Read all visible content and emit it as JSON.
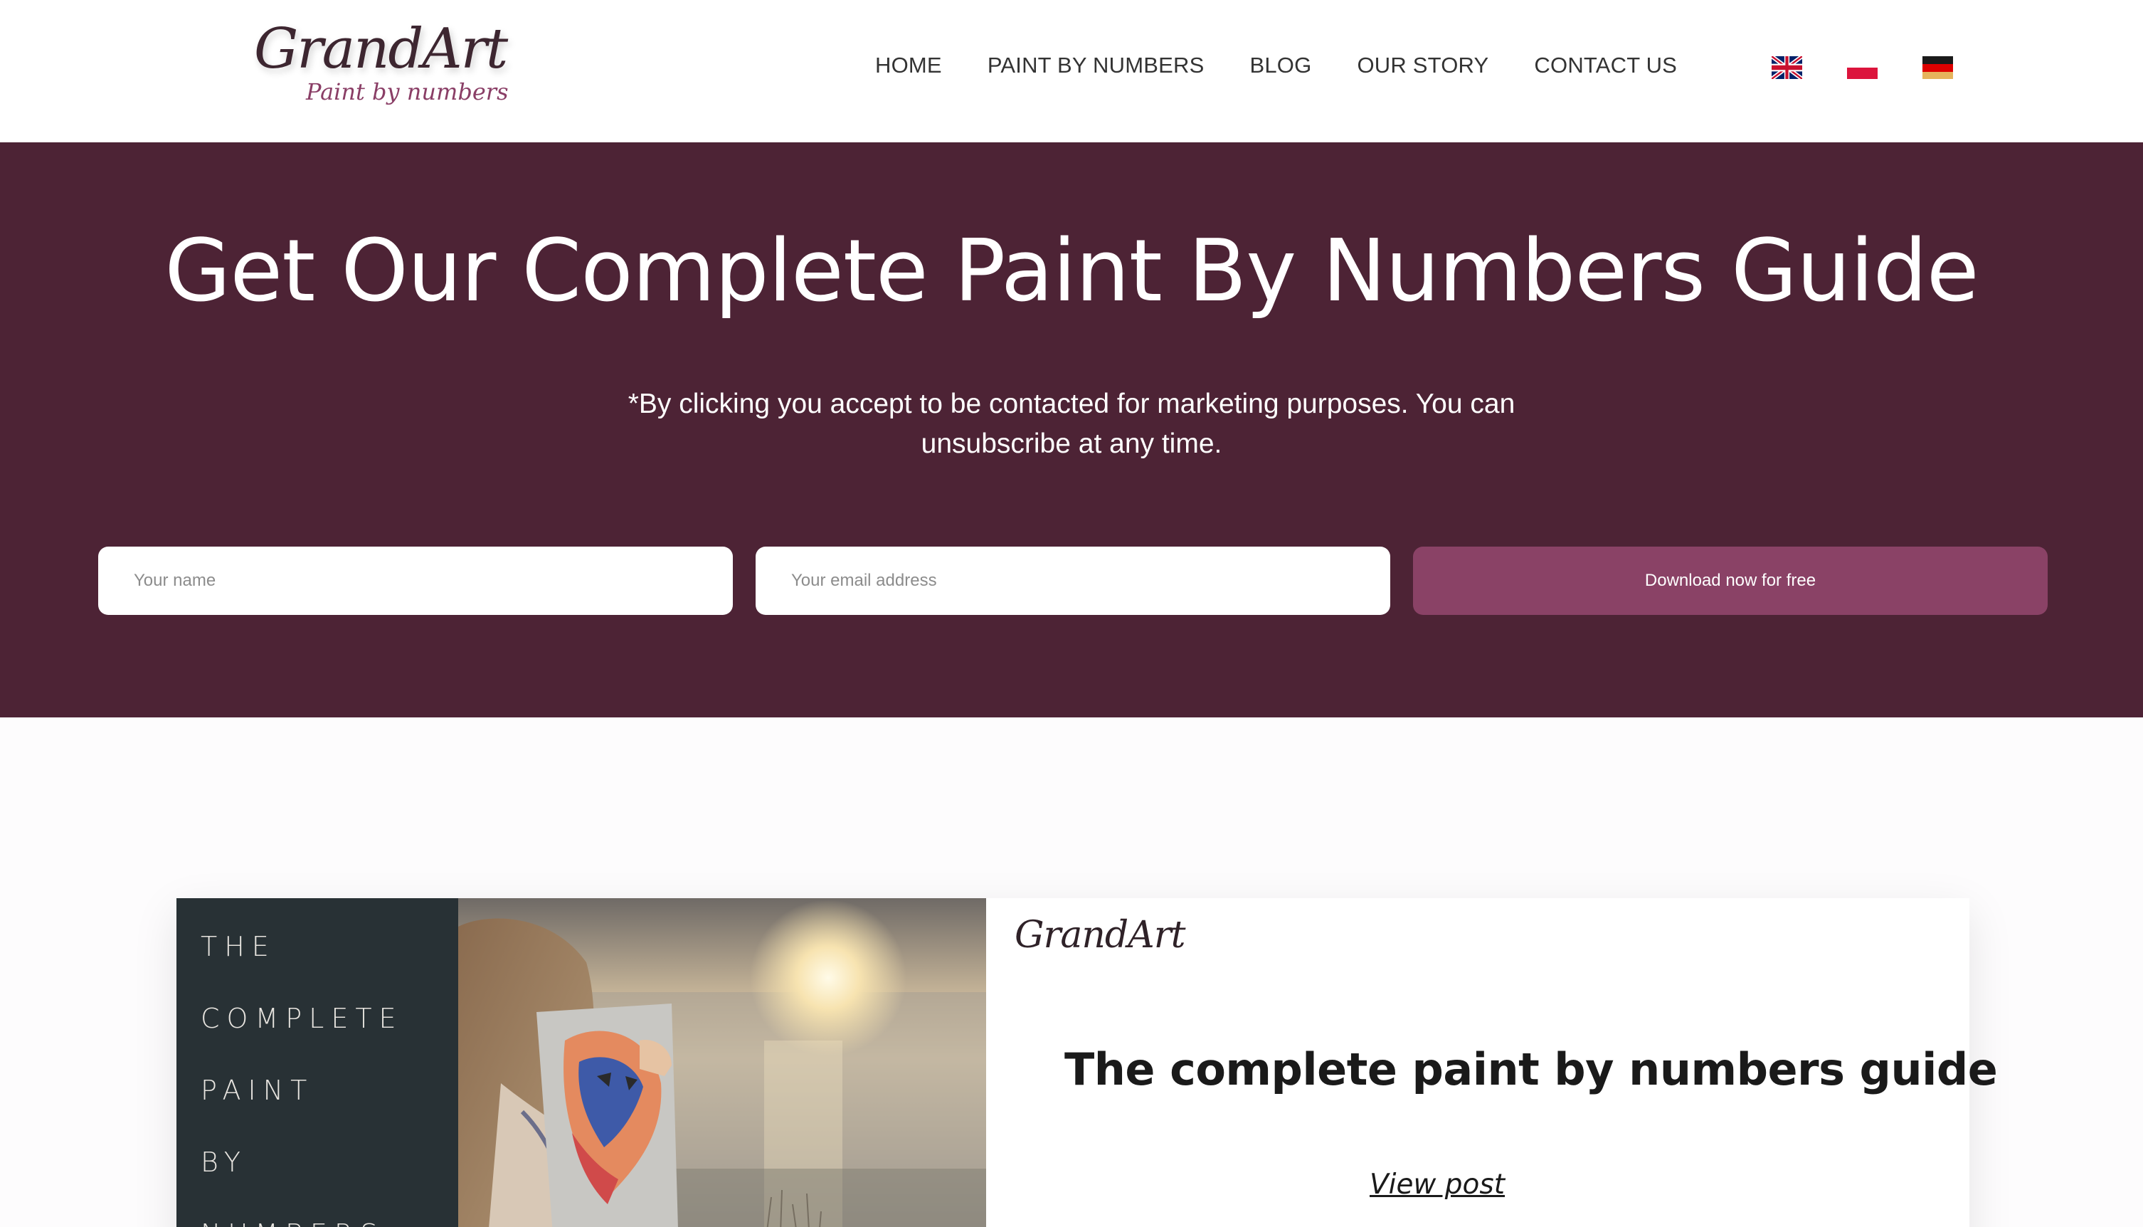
{
  "header": {
    "logo": {
      "main": "GrandArt",
      "sub": "Paint by numbers"
    },
    "nav": [
      {
        "label": "HOME"
      },
      {
        "label": "PAINT BY NUMBERS"
      },
      {
        "label": "BLOG"
      },
      {
        "label": "OUR STORY"
      },
      {
        "label": "CONTACT US"
      }
    ],
    "languages": [
      {
        "icon": "uk-flag-icon"
      },
      {
        "icon": "poland-flag-icon"
      },
      {
        "icon": "germany-flag-icon"
      }
    ]
  },
  "hero": {
    "title": "Get Our Complete Paint By Numbers Guide",
    "note": "*By clicking you accept to be contacted for marketing purposes. You can unsubscribe at any time.",
    "name_placeholder": "Your name",
    "email_placeholder": "Your email address",
    "button_label": "Download now for free",
    "background_color": "#4d2335",
    "button_color": "#8a4266"
  },
  "post": {
    "cover_words": [
      "THE",
      "COMPLETE",
      "PAINT",
      "BY",
      "NUMBERS"
    ],
    "photo_logo": "GrandArt",
    "title": "The complete paint by numbers guide",
    "link_label": "View post"
  }
}
